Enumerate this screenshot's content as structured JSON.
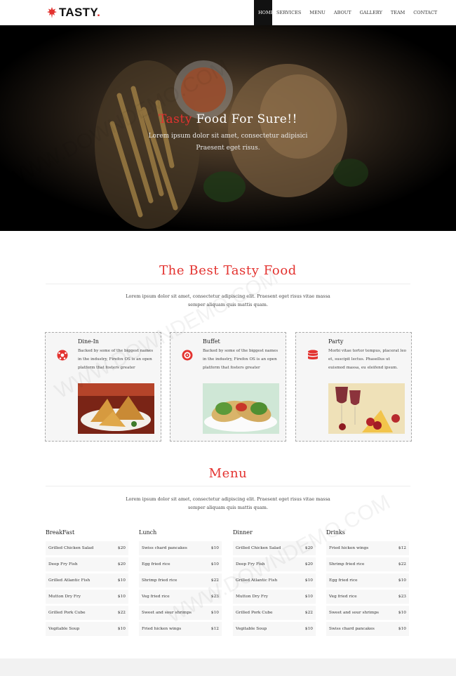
{
  "nav": {
    "logo_text": "TASTY",
    "logo_dot": ".",
    "items": [
      "HOME",
      "SERVICES",
      "MENU",
      "ABOUT",
      "GALLERY",
      "TEAM",
      "CONTACT"
    ],
    "active_index": 0
  },
  "hero": {
    "title_accent": "Tasty",
    "title_rest": " Food For Sure!!",
    "subtitle_line1": "Lorem ipsum dolor sit amet, consectetur adipisici",
    "subtitle_line2": "Praesent eget risus."
  },
  "services": {
    "title": "The Best Tasty Food",
    "desc_line1": "Lorem ipsum dolor sit amet, consectetur adipiscing elit. Praesent eget risus vitae massa",
    "desc_line2": "semper aliquam quis mattis quam.",
    "cards": [
      {
        "title": "Dine-In",
        "text": "Backed by some of the biggest names in the industry, Firefox OS is an open platform that fosters greater",
        "icon": "soccer-ball-icon"
      },
      {
        "title": "Buffet",
        "text": "Backed by some of the biggest names in the industry, Firefox OS is an open platform that fosters greater",
        "icon": "target-icon"
      },
      {
        "title": "Party",
        "text": "Morbi vitae tortor tempus, placerat leo et, suscipit lectus. Phasellus ut euismod massa, eu eleifend ipsum.",
        "icon": "database-icon"
      }
    ]
  },
  "menu": {
    "title": "Menu",
    "desc_line1": "Lorem ipsum dolor sit amet, consectetur adipiscing elit. Praesent eget risus vitae massa",
    "desc_line2": "semper aliquam quis mattis quam.",
    "columns": [
      {
        "title": "BreakFast",
        "items": [
          {
            "name": "Grilled Chicken Salad",
            "price": "$20"
          },
          {
            "name": "Deep Fry Fish",
            "price": "$20"
          },
          {
            "name": "Grilled Atlantic Fish",
            "price": "$10"
          },
          {
            "name": "Mutton Dry Fry",
            "price": "$10"
          },
          {
            "name": "Grilled Pork Cube",
            "price": "$22"
          },
          {
            "name": "Vegitable Soup",
            "price": "$10"
          }
        ]
      },
      {
        "title": "Lunch",
        "items": [
          {
            "name": "Swiss chard pancakes",
            "price": "$10"
          },
          {
            "name": "Egg fried rice",
            "price": "$10"
          },
          {
            "name": "Shrimp fried rice",
            "price": "$22"
          },
          {
            "name": "Veg fried rice",
            "price": "$23"
          },
          {
            "name": "Sweet and sour shrimps",
            "price": "$10"
          },
          {
            "name": "Fried hicken wings",
            "price": "$12"
          }
        ]
      },
      {
        "title": "Dinner",
        "items": [
          {
            "name": "Grilled Chicken Salad",
            "price": "$20"
          },
          {
            "name": "Deep Fry Fish",
            "price": "$20"
          },
          {
            "name": "Grilled Atlantic Fish",
            "price": "$10"
          },
          {
            "name": "Mutton Dry Fry",
            "price": "$10"
          },
          {
            "name": "Grilled Pork Cube",
            "price": "$22"
          },
          {
            "name": "Vegitable Soup",
            "price": "$10"
          }
        ]
      },
      {
        "title": "Drinks",
        "items": [
          {
            "name": "Fried hicken wings",
            "price": "$12"
          },
          {
            "name": "Shrimp fried rice",
            "price": "$22"
          },
          {
            "name": "Egg fried rice",
            "price": "$10"
          },
          {
            "name": "Veg fried rice",
            "price": "$23"
          },
          {
            "name": "Sweet and sour shrimps",
            "price": "$10"
          },
          {
            "name": "Swiss chard pancakes",
            "price": "$10"
          }
        ]
      }
    ]
  },
  "watermark": "WWW.DOWNDEMO.COM",
  "colors": {
    "accent": "#e3322f",
    "nav_active": "#111111",
    "card_bg": "#f6f6f6"
  }
}
